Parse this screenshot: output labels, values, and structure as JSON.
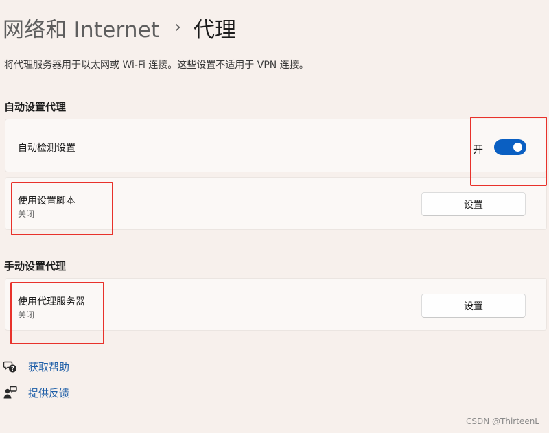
{
  "header": {
    "parent": "网络和 Internet",
    "separator": "›",
    "current": "代理"
  },
  "description": "将代理服务器用于以太网或 Wi-Fi 连接。这些设置不适用于 VPN 连接。",
  "auto_section": {
    "heading": "自动设置代理",
    "auto_detect": {
      "label": "自动检测设置",
      "toggle_state": "开",
      "toggle_on": true
    },
    "script": {
      "label": "使用设置脚本",
      "status": "关闭",
      "button": "设置"
    }
  },
  "manual_section": {
    "heading": "手动设置代理",
    "proxy_server": {
      "label": "使用代理服务器",
      "status": "关闭",
      "button": "设置"
    }
  },
  "links": [
    {
      "label": "获取帮助",
      "icon": "help-chat-icon"
    },
    {
      "label": "提供反馈",
      "icon": "feedback-icon"
    }
  ],
  "watermark": "CSDN @ThirteenL",
  "colors": {
    "accent": "#0a5fc2",
    "link": "#1f5fa8",
    "annotation": "#e8322b",
    "background": "#f7f0ec"
  }
}
